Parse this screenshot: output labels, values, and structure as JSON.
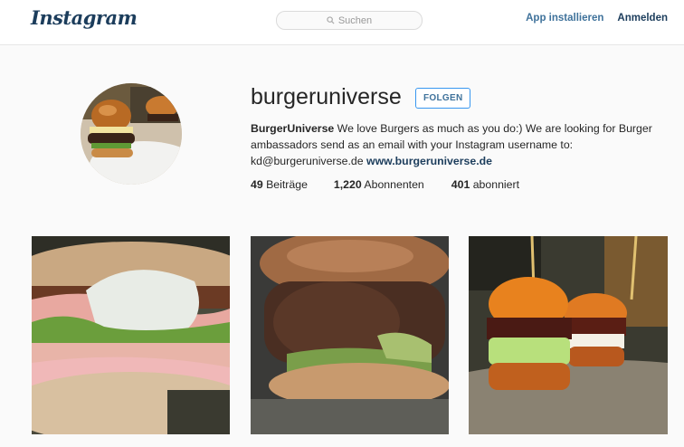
{
  "header": {
    "logo": "Instagram",
    "search_placeholder": "Suchen",
    "install_label": "App installieren",
    "login_label": "Anmelden"
  },
  "profile": {
    "username": "burgeruniverse",
    "follow_label": "FOLGEN",
    "bio_name": "BurgerUniverse",
    "bio_text": " We love Burgers as much as you do:) We are looking for Burger ambassadors send as an email with your Instagram username to: kd@burgeruniverse.de ",
    "website": "www.burgeruniverse.de",
    "stats": [
      {
        "count": "49",
        "label": " Beiträge"
      },
      {
        "count": "1,220",
        "label": " Abonnenten"
      },
      {
        "count": "401",
        "label": " abonniert"
      }
    ]
  },
  "colors": {
    "accent": "#3f729b",
    "dark_link": "#1c3d5c",
    "follow_border": "#3897f0"
  },
  "posts": [
    {
      "icon": "burger-photo"
    },
    {
      "icon": "burger-photo"
    },
    {
      "icon": "sliders-photo"
    }
  ]
}
